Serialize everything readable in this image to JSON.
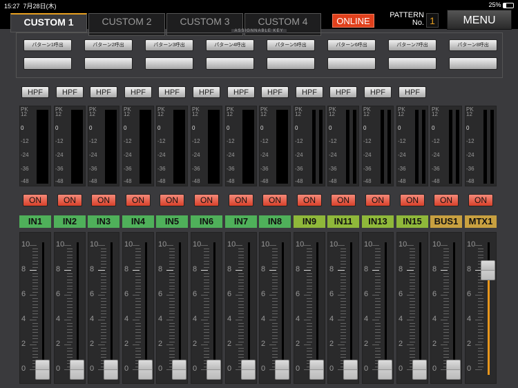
{
  "status": {
    "time": "15:27",
    "date": "7月28日(木)",
    "battery": "25%"
  },
  "tabs": [
    "CUSTOM 1",
    "CUSTOM 2",
    "CUSTOM 3",
    "CUSTOM 4"
  ],
  "active_tab": 0,
  "online": "ONLINE",
  "pattern": {
    "label1": "PATTERN",
    "label2": "No.",
    "value": "1"
  },
  "menu": "MENU",
  "assignable": {
    "title": "ASSIGNNABLE KEY",
    "row1": [
      "パターン1呼出",
      "パターン2呼出",
      "パターン3呼出",
      "パターン4呼出",
      "パターン5呼出",
      "パターン6呼出",
      "パターン7呼出",
      "パターン8呼出"
    ],
    "row2": [
      "",
      "",
      "",
      "",
      "",
      "",
      "",
      ""
    ]
  },
  "hpf_label": "HPF",
  "on_label": "ON",
  "meter_scale": [
    "PK",
    "12",
    "0",
    "-12",
    "-24",
    "-36",
    "-48"
  ],
  "fader_scale": [
    "10",
    "8",
    "6",
    "4",
    "2",
    "0"
  ],
  "colors": {
    "input": "#4fb05a",
    "stereo": "#8fb83a",
    "bus": "#c8a040",
    "accent": "#e8961c"
  },
  "channels": [
    {
      "name": "IN1",
      "type": "input",
      "hpf": true,
      "stereo": false,
      "fader": 0
    },
    {
      "name": "IN2",
      "type": "input",
      "hpf": true,
      "stereo": false,
      "fader": 0
    },
    {
      "name": "IN3",
      "type": "input",
      "hpf": true,
      "stereo": false,
      "fader": 0
    },
    {
      "name": "IN4",
      "type": "input",
      "hpf": true,
      "stereo": false,
      "fader": 0
    },
    {
      "name": "IN5",
      "type": "input",
      "hpf": true,
      "stereo": false,
      "fader": 0
    },
    {
      "name": "IN6",
      "type": "input",
      "hpf": true,
      "stereo": false,
      "fader": 0
    },
    {
      "name": "IN7",
      "type": "input",
      "hpf": true,
      "stereo": false,
      "fader": 0
    },
    {
      "name": "IN8",
      "type": "input",
      "hpf": true,
      "stereo": false,
      "fader": 0
    },
    {
      "name": "IN9",
      "type": "stereo",
      "hpf": true,
      "stereo": true,
      "fader": 0
    },
    {
      "name": "IN11",
      "type": "stereo",
      "hpf": true,
      "stereo": true,
      "fader": 0
    },
    {
      "name": "IN13",
      "type": "stereo",
      "hpf": true,
      "stereo": true,
      "fader": 0
    },
    {
      "name": "IN15",
      "type": "stereo",
      "hpf": true,
      "stereo": true,
      "fader": 0
    },
    {
      "name": "BUS1",
      "type": "bus",
      "hpf": false,
      "stereo": true,
      "fader": 0
    },
    {
      "name": "MTX1",
      "type": "bus",
      "hpf": false,
      "stereo": true,
      "fader": 8
    }
  ]
}
